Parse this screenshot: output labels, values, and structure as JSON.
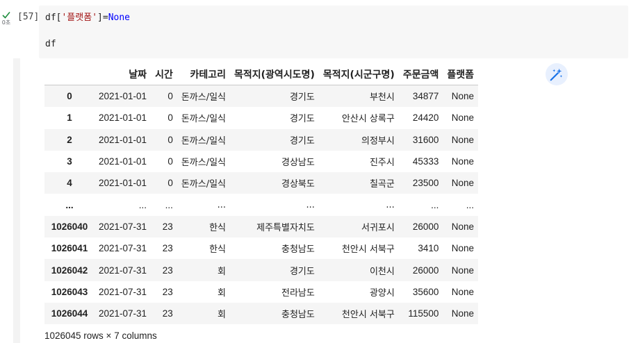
{
  "cell": {
    "exec_count": "[57]",
    "exec_time": "0초",
    "code_line1": {
      "prefix": "df[",
      "string": "'플랫폼'",
      "eq": "]=",
      "const": "None"
    },
    "code_line2": "df"
  },
  "table": {
    "index_header": "",
    "columns": [
      "날짜",
      "시간",
      "카테고리",
      "목적지(광역시도명)",
      "목적지(시군구명)",
      "주문금액",
      "플랫폼"
    ],
    "rows": [
      {
        "index": "0",
        "cells": [
          "2021-01-01",
          "0",
          "돈까스/일식",
          "경기도",
          "부천시",
          "34877",
          "None"
        ]
      },
      {
        "index": "1",
        "cells": [
          "2021-01-01",
          "0",
          "돈까스/일식",
          "경기도",
          "안산시 상록구",
          "24420",
          "None"
        ]
      },
      {
        "index": "2",
        "cells": [
          "2021-01-01",
          "0",
          "돈까스/일식",
          "경기도",
          "의정부시",
          "31600",
          "None"
        ]
      },
      {
        "index": "3",
        "cells": [
          "2021-01-01",
          "0",
          "돈까스/일식",
          "경상남도",
          "진주시",
          "45333",
          "None"
        ]
      },
      {
        "index": "4",
        "cells": [
          "2021-01-01",
          "0",
          "돈까스/일식",
          "경상북도",
          "칠곡군",
          "23500",
          "None"
        ]
      },
      {
        "index": "...",
        "cells": [
          "...",
          "...",
          "...",
          "...",
          "...",
          "...",
          "..."
        ]
      },
      {
        "index": "1026040",
        "cells": [
          "2021-07-31",
          "23",
          "한식",
          "제주특별자치도",
          "서귀포시",
          "26000",
          "None"
        ]
      },
      {
        "index": "1026041",
        "cells": [
          "2021-07-31",
          "23",
          "한식",
          "충청남도",
          "천안시 서북구",
          "3410",
          "None"
        ]
      },
      {
        "index": "1026042",
        "cells": [
          "2021-07-31",
          "23",
          "회",
          "경기도",
          "이천시",
          "26000",
          "None"
        ]
      },
      {
        "index": "1026043",
        "cells": [
          "2021-07-31",
          "23",
          "회",
          "전라남도",
          "광양시",
          "35600",
          "None"
        ]
      },
      {
        "index": "1026044",
        "cells": [
          "2021-07-31",
          "23",
          "회",
          "충청남도",
          "천안시 서북구",
          "115500",
          "None"
        ]
      }
    ]
  },
  "shape": "1026045 rows × 7 columns",
  "icons": {
    "status": "check-icon",
    "magic": "magic-wand-icon"
  },
  "colors": {
    "check": "#1e8e3e",
    "magic": "#1a73e8",
    "string": "#a31515",
    "const": "#0000ff"
  }
}
